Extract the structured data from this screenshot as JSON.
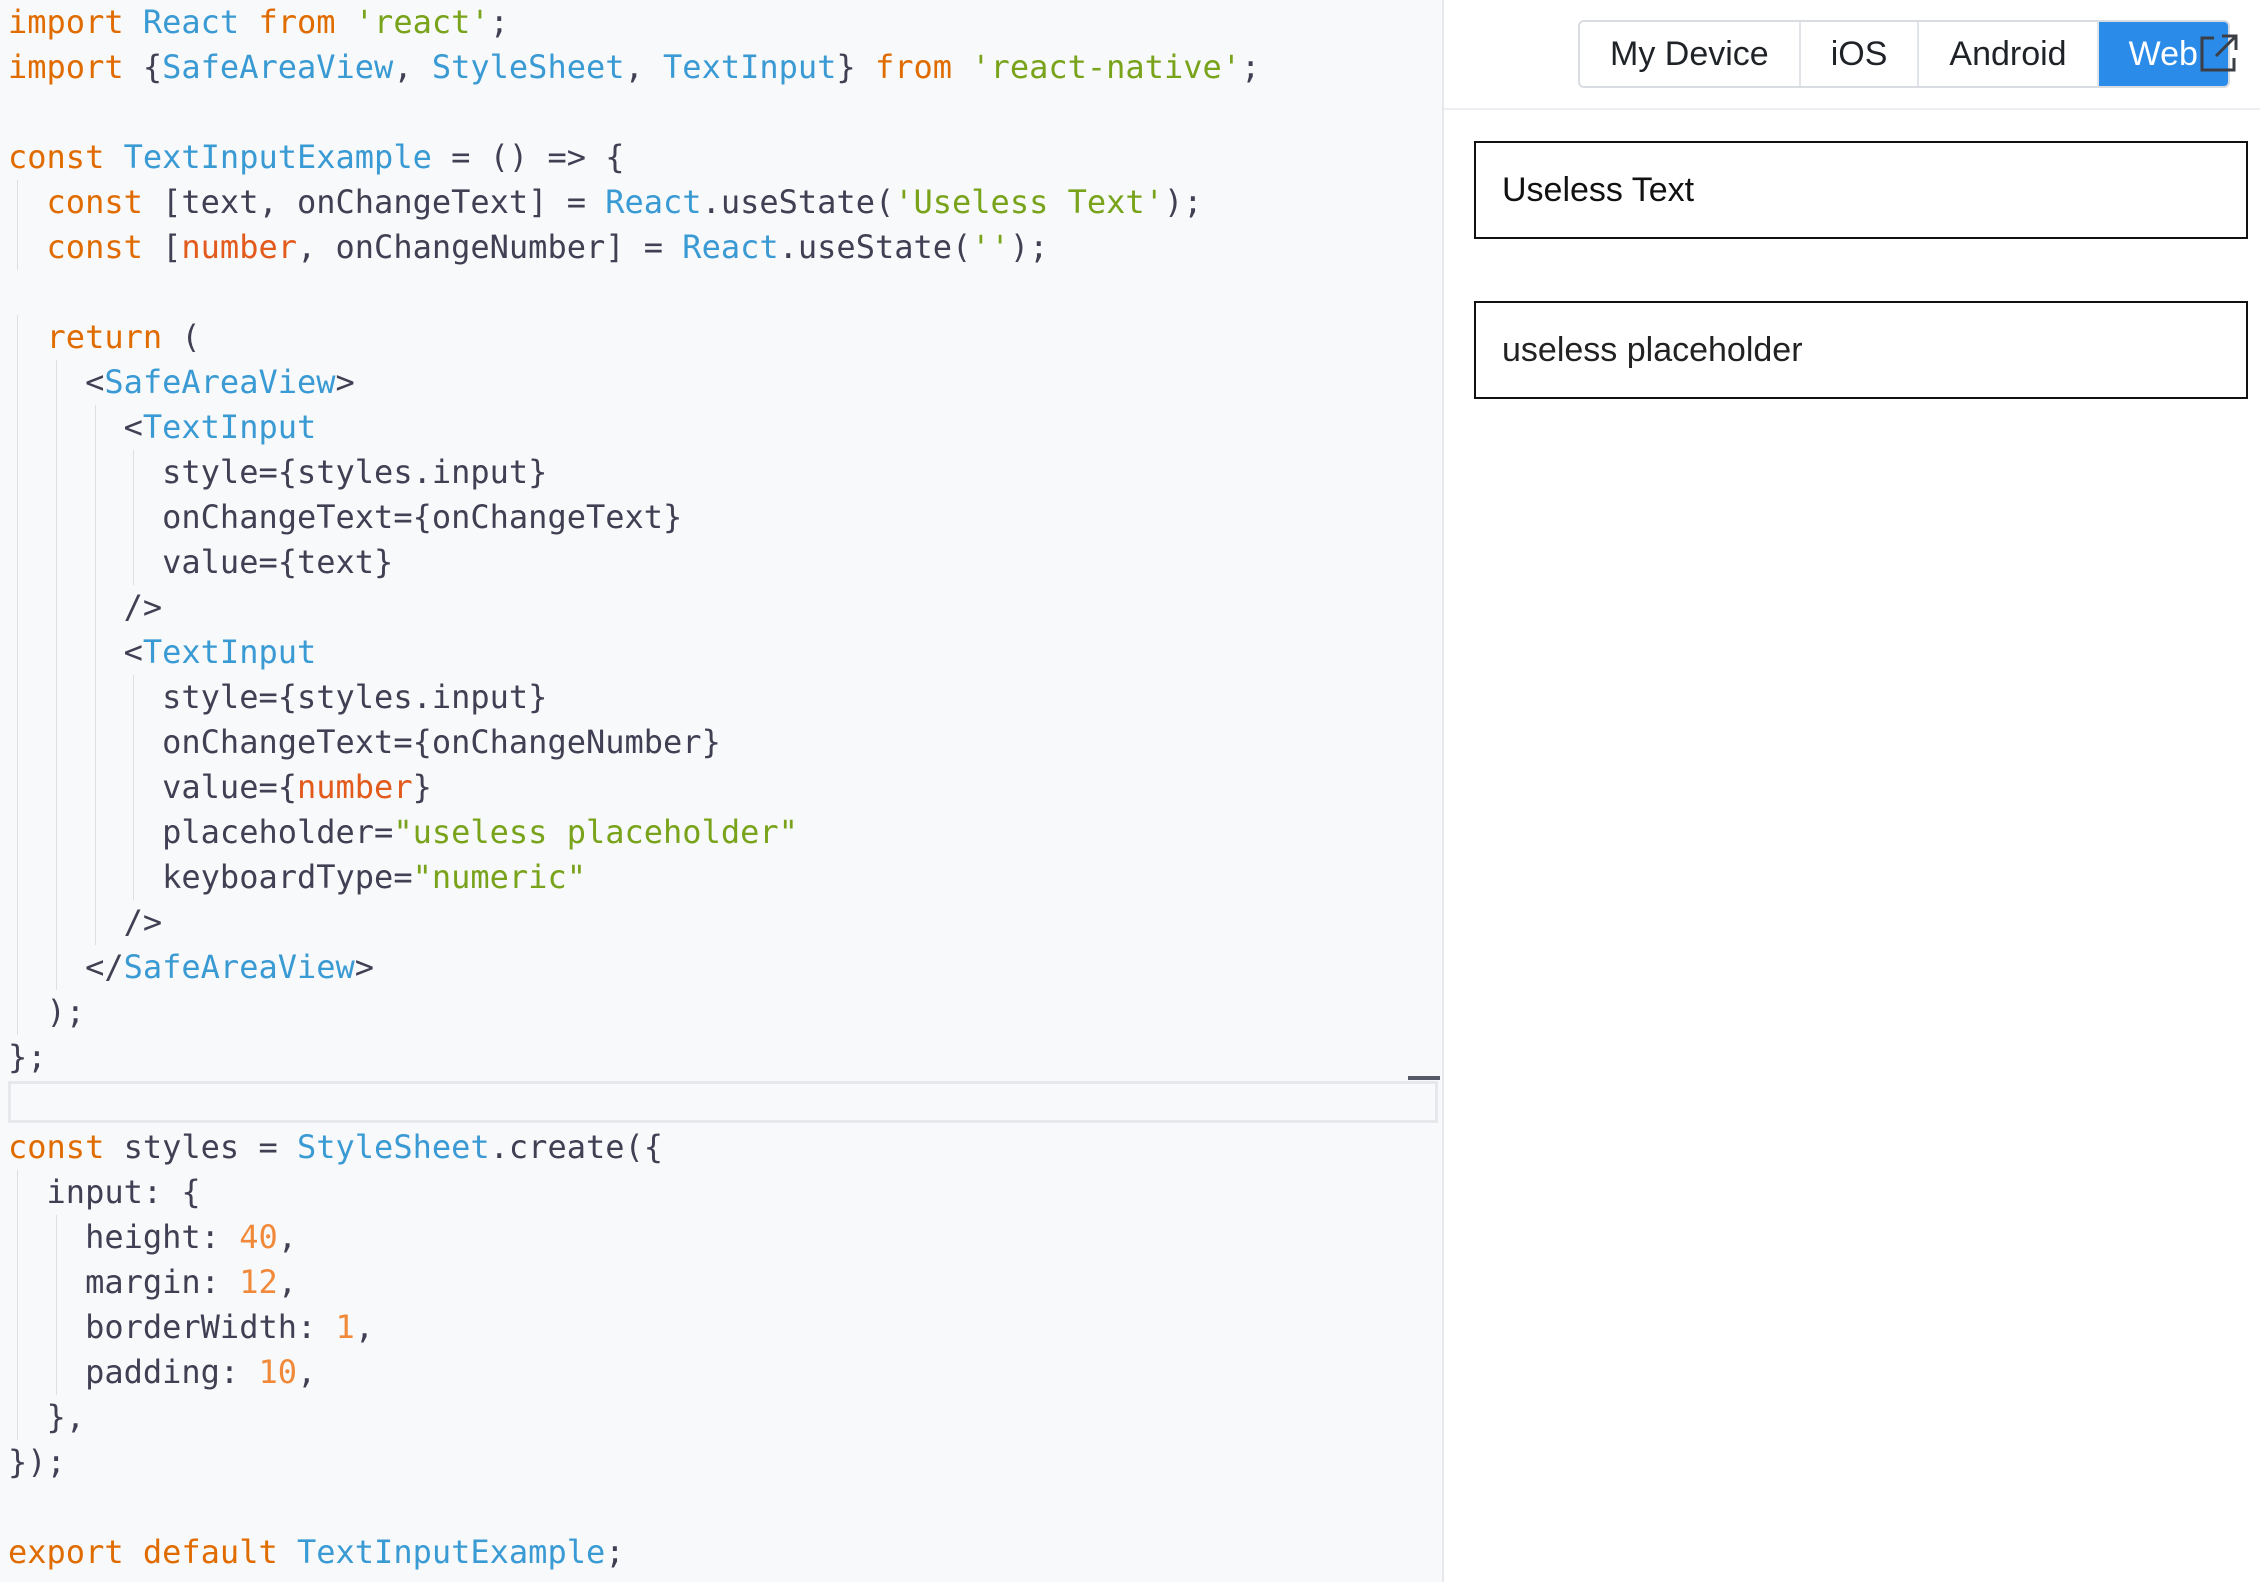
{
  "editor": {
    "lines": [
      [
        {
          "t": "import",
          "c": "k"
        },
        {
          "t": " "
        },
        {
          "t": "React",
          "c": "c"
        },
        {
          "t": " "
        },
        {
          "t": "from",
          "c": "k"
        },
        {
          "t": " "
        },
        {
          "t": "'react'",
          "c": "s"
        },
        {
          "t": ";"
        }
      ],
      [
        {
          "t": "import",
          "c": "k"
        },
        {
          "t": " {"
        },
        {
          "t": "SafeAreaView",
          "c": "c"
        },
        {
          "t": ", "
        },
        {
          "t": "StyleSheet",
          "c": "c"
        },
        {
          "t": ", "
        },
        {
          "t": "TextInput",
          "c": "c"
        },
        {
          "t": "} "
        },
        {
          "t": "from",
          "c": "k"
        },
        {
          "t": " "
        },
        {
          "t": "'react-native'",
          "c": "s"
        },
        {
          "t": ";"
        }
      ],
      [],
      [
        {
          "t": "const",
          "c": "k"
        },
        {
          "t": " "
        },
        {
          "t": "TextInputExample",
          "c": "c"
        },
        {
          "t": " = () => {"
        }
      ],
      [
        {
          "t": "  "
        },
        {
          "t": "const",
          "c": "k"
        },
        {
          "t": " [text, onChangeText] = "
        },
        {
          "t": "React",
          "c": "c"
        },
        {
          "t": ".useState("
        },
        {
          "t": "'Useless Text'",
          "c": "s"
        },
        {
          "t": ");"
        }
      ],
      [
        {
          "t": "  "
        },
        {
          "t": "const",
          "c": "k"
        },
        {
          "t": " ["
        },
        {
          "t": "number",
          "c": "v"
        },
        {
          "t": ", onChangeNumber] = "
        },
        {
          "t": "React",
          "c": "c"
        },
        {
          "t": ".useState("
        },
        {
          "t": "''",
          "c": "s"
        },
        {
          "t": ");"
        }
      ],
      [],
      [
        {
          "t": "  "
        },
        {
          "t": "return",
          "c": "k"
        },
        {
          "t": " ("
        }
      ],
      [
        {
          "t": "    <"
        },
        {
          "t": "SafeAreaView",
          "c": "c"
        },
        {
          "t": ">"
        }
      ],
      [
        {
          "t": "      <"
        },
        {
          "t": "TextInput",
          "c": "c"
        }
      ],
      [
        {
          "t": "        style={styles.input}"
        }
      ],
      [
        {
          "t": "        onChangeText={onChangeText}"
        }
      ],
      [
        {
          "t": "        value={text}"
        }
      ],
      [
        {
          "t": "      />"
        }
      ],
      [
        {
          "t": "      <"
        },
        {
          "t": "TextInput",
          "c": "c"
        }
      ],
      [
        {
          "t": "        style={styles.input}"
        }
      ],
      [
        {
          "t": "        onChangeText={onChangeNumber}"
        }
      ],
      [
        {
          "t": "        value={"
        },
        {
          "t": "number",
          "c": "v"
        },
        {
          "t": "}"
        }
      ],
      [
        {
          "t": "        placeholder="
        },
        {
          "t": "\"useless placeholder\"",
          "c": "s"
        }
      ],
      [
        {
          "t": "        keyboardType="
        },
        {
          "t": "\"numeric\"",
          "c": "s"
        }
      ],
      [
        {
          "t": "      />"
        }
      ],
      [
        {
          "t": "    </"
        },
        {
          "t": "SafeAreaView",
          "c": "c"
        },
        {
          "t": ">"
        }
      ],
      [
        {
          "t": "  );"
        }
      ],
      [
        {
          "t": "};"
        }
      ],
      [],
      [
        {
          "t": "const",
          "c": "k"
        },
        {
          "t": " styles = "
        },
        {
          "t": "StyleSheet",
          "c": "c"
        },
        {
          "t": ".create({"
        }
      ],
      [
        {
          "t": "  input: {"
        }
      ],
      [
        {
          "t": "    height: "
        },
        {
          "t": "40",
          "c": "n"
        },
        {
          "t": ","
        }
      ],
      [
        {
          "t": "    margin: "
        },
        {
          "t": "12",
          "c": "n"
        },
        {
          "t": ","
        }
      ],
      [
        {
          "t": "    borderWidth: "
        },
        {
          "t": "1",
          "c": "n"
        },
        {
          "t": ","
        }
      ],
      [
        {
          "t": "    padding: "
        },
        {
          "t": "10",
          "c": "n"
        },
        {
          "t": ","
        }
      ],
      [
        {
          "t": "  },"
        }
      ],
      [
        {
          "t": "});"
        }
      ],
      [],
      [
        {
          "t": "export",
          "c": "k"
        },
        {
          "t": " "
        },
        {
          "t": "default",
          "c": "k"
        },
        {
          "t": " "
        },
        {
          "t": "TextInputExample",
          "c": "c"
        },
        {
          "t": ";"
        }
      ]
    ]
  },
  "preview": {
    "platforms": [
      "My Device",
      "iOS",
      "Android",
      "Web"
    ],
    "active_platform": "Web",
    "open_icon": "external-link-icon",
    "text_input": {
      "value": "Useless Text"
    },
    "number_input": {
      "value": "",
      "placeholder": "useless placeholder"
    }
  },
  "colors": {
    "accent": "#2b8be8",
    "keyword": "#e06c00",
    "component": "#3a9ad3",
    "string": "#78a31a",
    "number": "#f08a3a"
  }
}
